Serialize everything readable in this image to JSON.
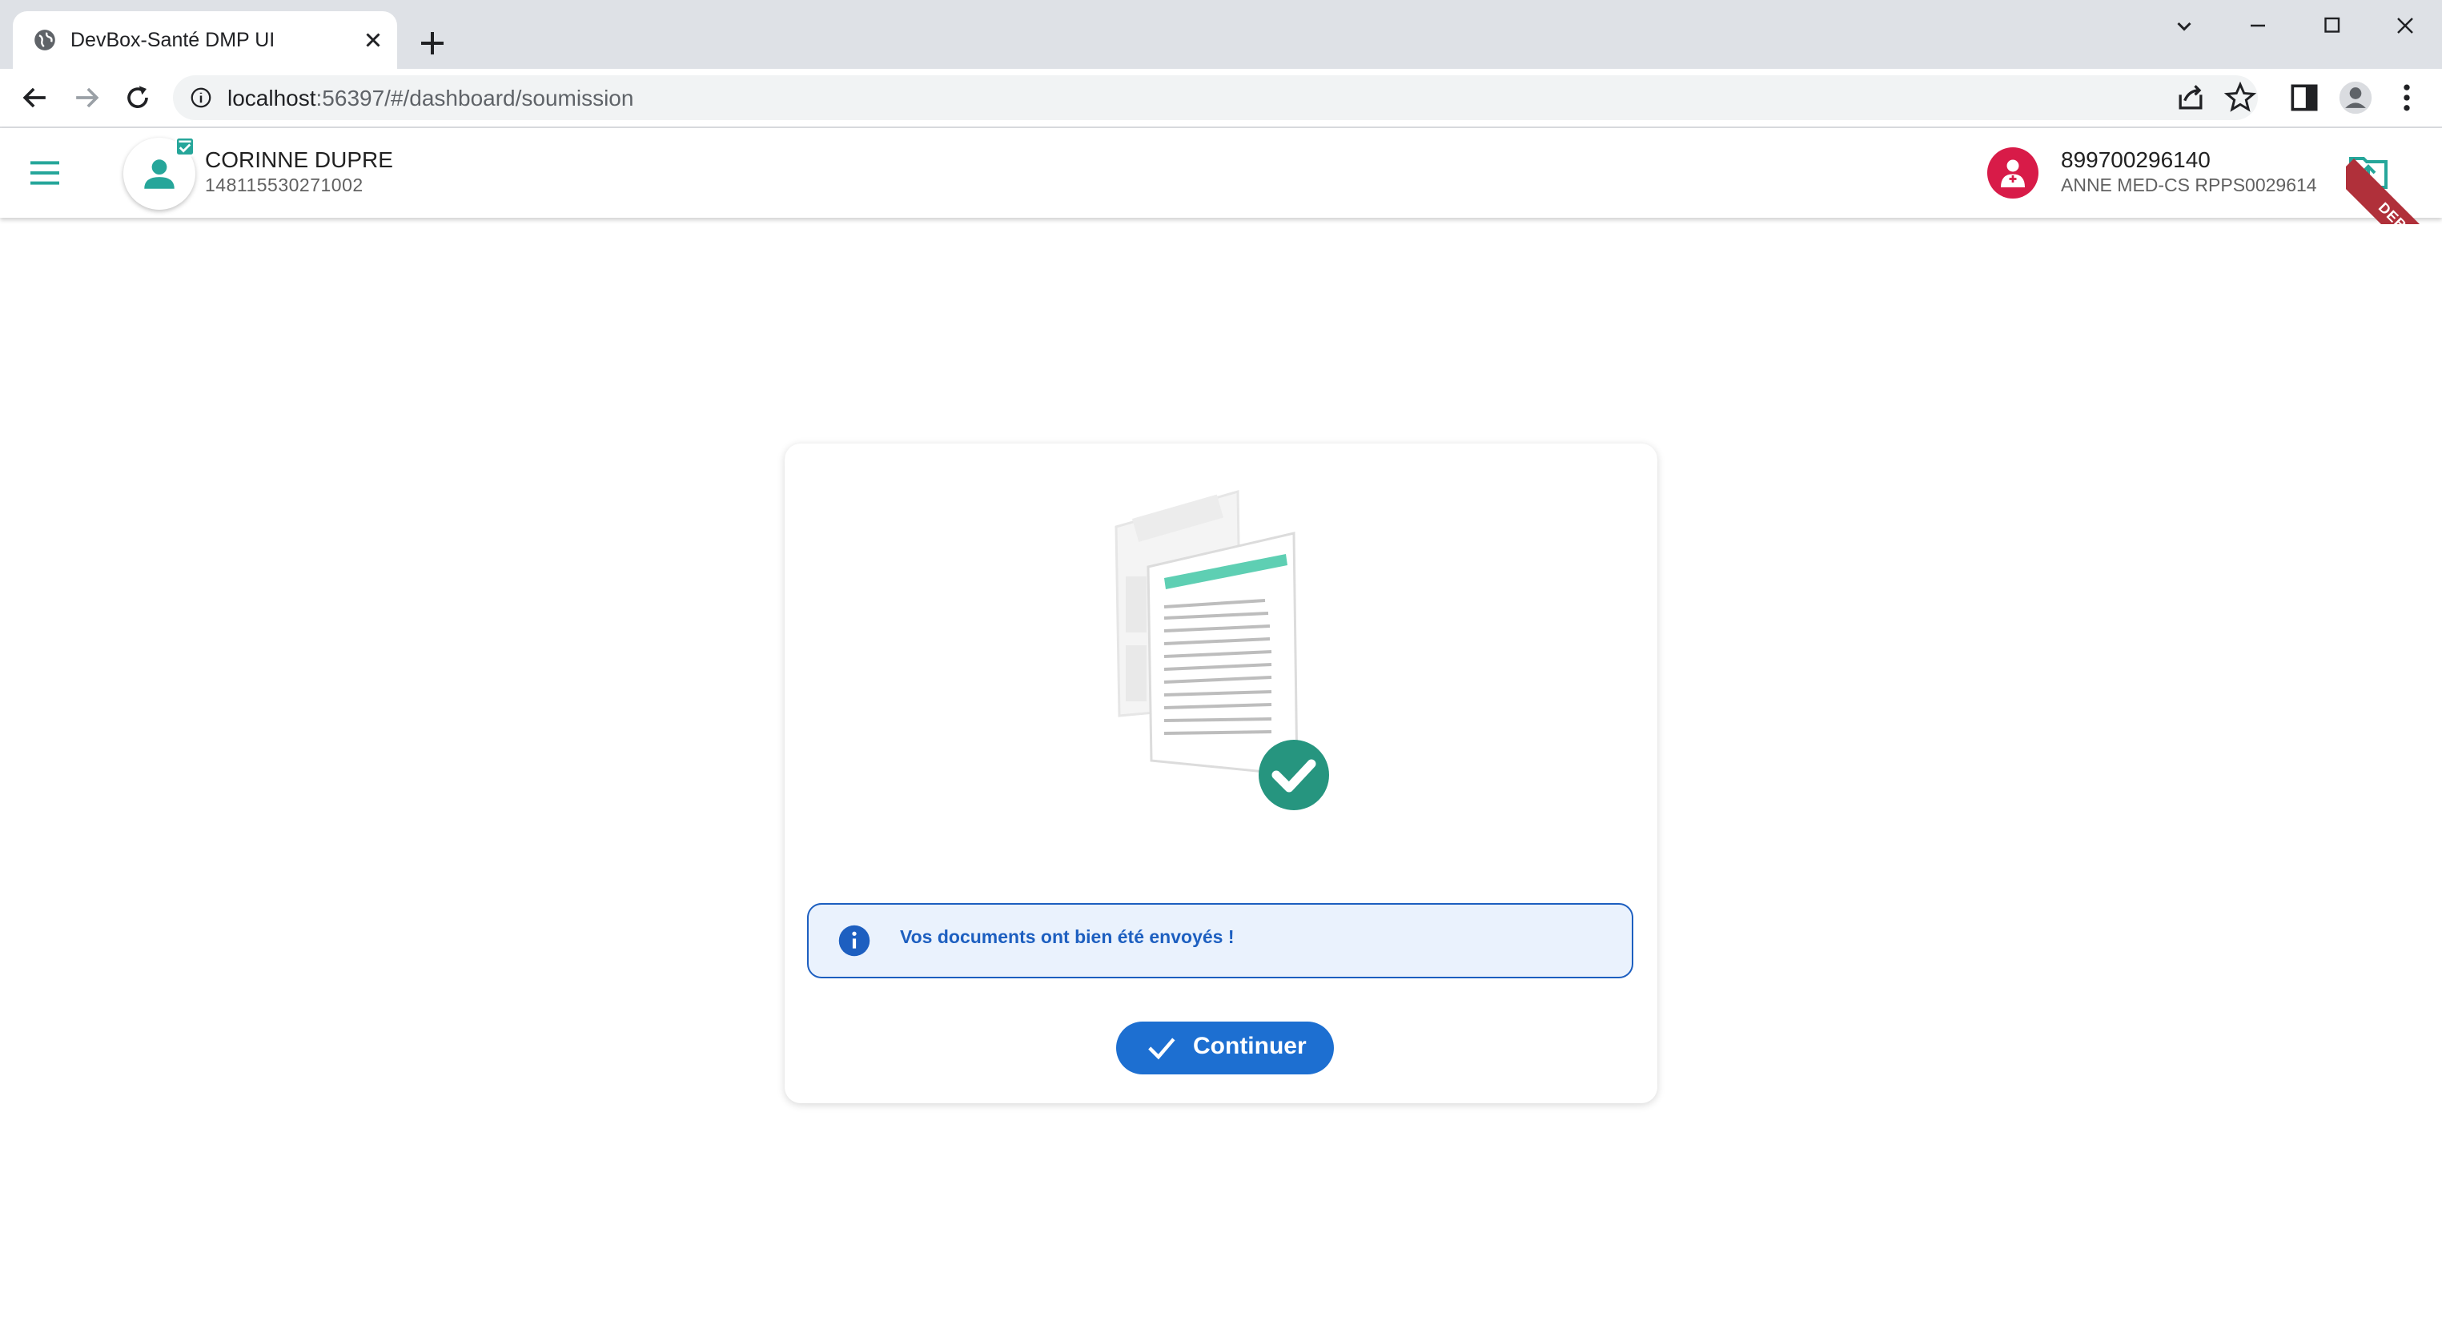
{
  "browser": {
    "tab_title": "DevBox-Santé DMP UI",
    "url_host": "localhost",
    "url_rest": ":56397/#/dashboard/soumission"
  },
  "header": {
    "patient": {
      "name": "CORINNE DUPRE",
      "id": "148115530271002"
    },
    "doctor": {
      "code": "899700296140",
      "name": "ANNE MED-CS RPPS0029614"
    },
    "debug_label": "DEBUG"
  },
  "main": {
    "alert_message": "Vos documents ont bien été envoyés !",
    "continue_label": "Continuer"
  },
  "colors": {
    "accent_teal": "#26a69a",
    "primary_blue": "#1d6fd1",
    "doctor_red": "#d81b48"
  }
}
